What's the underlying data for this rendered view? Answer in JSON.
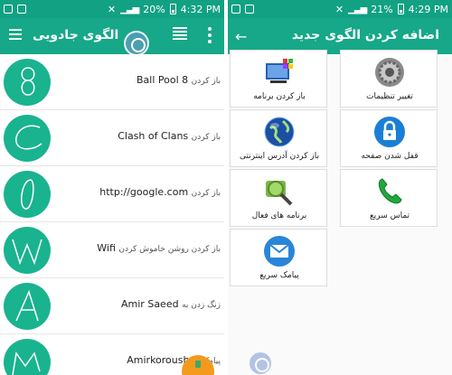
{
  "left_screen": {
    "status_bar": {
      "battery": "20%",
      "time": "4:32 PM"
    },
    "app_bar": {
      "title": "الگوی جادویی"
    },
    "patterns": [
      {
        "action": "باز کردن",
        "target": "8 Ball Pool",
        "glyph": "8"
      },
      {
        "action": "باز کردن",
        "target": "Clash of Clans",
        "glyph": "C"
      },
      {
        "action": "باز کردن",
        "target": "http://google.com",
        "glyph": "0"
      },
      {
        "action": "باز کردن روشن خاموش کردن",
        "target": "Wifi",
        "glyph": "W"
      },
      {
        "action": "زنگ زدن به",
        "target": "Amir Saeed",
        "glyph": "A"
      },
      {
        "action": "پیامک به",
        "target": "Amirkoroush",
        "glyph": "M"
      }
    ]
  },
  "right_screen": {
    "status_bar": {
      "battery": "21%",
      "time": "4:29 PM"
    },
    "app_bar": {
      "title": "اضافه کردن الگوی جدید"
    },
    "options": [
      {
        "label": "تغییر تنظیمات",
        "icon": "settings-gear-icon"
      },
      {
        "label": "باز کردن برنامه",
        "icon": "apps-window-icon"
      },
      {
        "label": "قفل شدن صفحه",
        "icon": "lock-icon"
      },
      {
        "label": "باز کردن آدرس اینترنتی",
        "icon": "globe-icon"
      },
      {
        "label": "تماس سریع",
        "icon": "phone-icon"
      },
      {
        "label": "برنامه های فعال",
        "icon": "search-apps-icon"
      },
      {
        "label": "پیامک سریع",
        "icon": "envelope-icon"
      }
    ]
  },
  "colors": {
    "status_bar": "#12a183",
    "app_bar": "#16a888",
    "avatar": "#19b38f",
    "fab": "#f39a1d",
    "lock_tile": "#1a7fd4",
    "phone_tile": "#20a83c",
    "envelope_tile": "#2a85d6"
  }
}
